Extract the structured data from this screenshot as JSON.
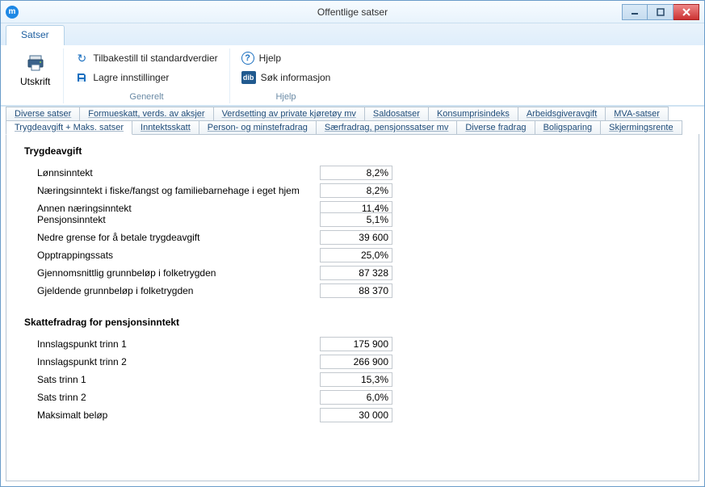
{
  "window": {
    "title": "Offentlige satser"
  },
  "ribbon": {
    "tab": "Satser",
    "print": "Utskrift",
    "reset": "Tilbakestill til standardverdier",
    "save": "Lagre innstillinger",
    "help": "Hjelp",
    "search": "Søk informasjon",
    "group_general": "Generelt",
    "group_help": "Hjelp"
  },
  "tabs_row1": [
    "Diverse satser",
    "Formueskatt, verds. av aksjer",
    "Verdsetting av private kjøretøy mv",
    "Saldosatser",
    "Konsumprisindeks",
    "Arbeidsgiveravgift",
    "MVA-satser"
  ],
  "tabs_row2": [
    "Trygdeavgift + Maks. satser",
    "Inntektsskatt",
    "Person- og minstefradrag",
    "Særfradrag, pensjonssatser mv",
    "Diverse fradrag",
    "Boligsparing",
    "Skjermingsrente"
  ],
  "section1": {
    "title": "Trygdeavgift",
    "fields": [
      {
        "label": "Lønnsinntekt",
        "value": "8,2%"
      },
      {
        "label": "Næringsinntekt i fiske/fangst og familiebarnehage i eget hjem",
        "value": "8,2%"
      },
      {
        "label": "Annen næringsinntekt",
        "value": "11,4%"
      },
      {
        "label": "Pensjonsinntekt",
        "value": "5,1%"
      },
      {
        "label": "Nedre grense for å betale trygdeavgift",
        "value": "39 600"
      },
      {
        "label": "Opptrappingssats",
        "value": "25,0%"
      },
      {
        "label": "Gjennomsnittlig grunnbeløp i folketrygden",
        "value": "87 328"
      },
      {
        "label": "Gjeldende grunnbeløp i folketrygden",
        "value": "88 370"
      }
    ]
  },
  "section2": {
    "title": "Skattefradrag for pensjonsinntekt",
    "fields": [
      {
        "label": "Innslagspunkt trinn 1",
        "value": "175 900"
      },
      {
        "label": "Innslagspunkt trinn 2",
        "value": "266 900"
      },
      {
        "label": "Sats trinn 1",
        "value": "15,3%"
      },
      {
        "label": "Sats trinn 2",
        "value": "6,0%"
      },
      {
        "label": "Maksimalt beløp",
        "value": "30 000"
      }
    ]
  },
  "chart_data": {
    "type": "table",
    "title": "Trygdeavgift + Maks. satser",
    "rows": [
      {
        "group": "Trygdeavgift",
        "label": "Lønnsinntekt",
        "value": 8.2,
        "unit": "%"
      },
      {
        "group": "Trygdeavgift",
        "label": "Næringsinntekt i fiske/fangst og familiebarnehage i eget hjem",
        "value": 8.2,
        "unit": "%"
      },
      {
        "group": "Trygdeavgift",
        "label": "Annen næringsinntekt",
        "value": 11.4,
        "unit": "%"
      },
      {
        "group": "Trygdeavgift",
        "label": "Pensjonsinntekt",
        "value": 5.1,
        "unit": "%"
      },
      {
        "group": "Trygdeavgift",
        "label": "Nedre grense for å betale trygdeavgift",
        "value": 39600,
        "unit": ""
      },
      {
        "group": "Trygdeavgift",
        "label": "Opptrappingssats",
        "value": 25.0,
        "unit": "%"
      },
      {
        "group": "Trygdeavgift",
        "label": "Gjennomsnittlig grunnbeløp i folketrygden",
        "value": 87328,
        "unit": ""
      },
      {
        "group": "Trygdeavgift",
        "label": "Gjeldende grunnbeløp i folketrygden",
        "value": 88370,
        "unit": ""
      },
      {
        "group": "Skattefradrag for pensjonsinntekt",
        "label": "Innslagspunkt trinn 1",
        "value": 175900,
        "unit": ""
      },
      {
        "group": "Skattefradrag for pensjonsinntekt",
        "label": "Innslagspunkt trinn 2",
        "value": 266900,
        "unit": ""
      },
      {
        "group": "Skattefradrag for pensjonsinntekt",
        "label": "Sats trinn 1",
        "value": 15.3,
        "unit": "%"
      },
      {
        "group": "Skattefradrag for pensjonsinntekt",
        "label": "Sats trinn 2",
        "value": 6.0,
        "unit": "%"
      },
      {
        "group": "Skattefradrag for pensjonsinntekt",
        "label": "Maksimalt beløp",
        "value": 30000,
        "unit": ""
      }
    ]
  }
}
